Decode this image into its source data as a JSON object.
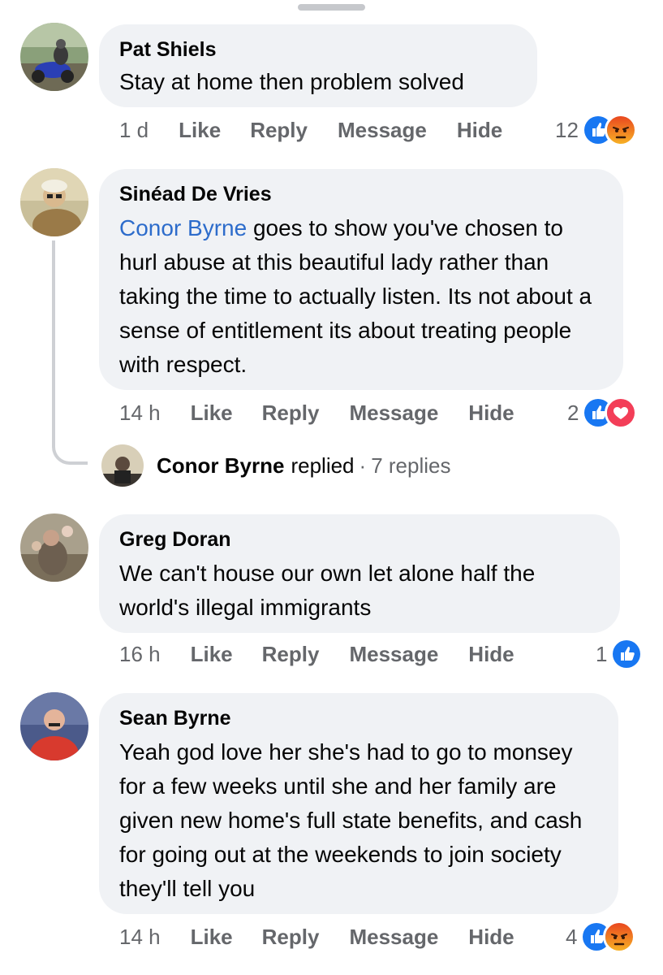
{
  "colors": {
    "like_blue": "#1877f2",
    "angry_orange": "#f0773a",
    "love_red": "#f33e58",
    "mention_blue": "#2d6ccb",
    "bubble_bg": "#f0f2f5",
    "meta_gray": "#65676b"
  },
  "comments": [
    {
      "author": "Pat Shiels",
      "text": "Stay at home then problem solved",
      "time": "1 d",
      "actions": [
        "Like",
        "Reply",
        "Message",
        "Hide"
      ],
      "reaction_count": "12",
      "reactions": [
        "like-icon",
        "angry-icon"
      ]
    },
    {
      "author": "Sinéad De Vries",
      "mention": "Conor Byrne",
      "text": " goes to show you've chosen to hurl abuse at this beautiful lady rather than taking the time to actually listen. Its not about a sense of entitlement its about treating people with respect.",
      "time": "14 h",
      "actions": [
        "Like",
        "Reply",
        "Message",
        "Hide"
      ],
      "reaction_count": "2",
      "reactions": [
        "like-icon",
        "love-icon"
      ],
      "reply_summary": {
        "name": "Conor Byrne",
        "verb": "replied",
        "separator": "·",
        "count": "7 replies"
      }
    },
    {
      "author": "Greg Doran",
      "text": "We can't house our own let alone half the world's illegal immigrants",
      "time": "16 h",
      "actions": [
        "Like",
        "Reply",
        "Message",
        "Hide"
      ],
      "reaction_count": "1",
      "reactions": [
        "like-icon"
      ]
    },
    {
      "author": "Sean Byrne",
      "text": "Yeah god love her she's had to go to monsey for a few weeks until she and her family are given new home's full state benefits, and cash for going out at the weekends to join society they'll tell you",
      "time": "14 h",
      "actions": [
        "Like",
        "Reply",
        "Message",
        "Hide"
      ],
      "reaction_count": "4",
      "reactions": [
        "like-icon",
        "angry-icon"
      ]
    }
  ]
}
